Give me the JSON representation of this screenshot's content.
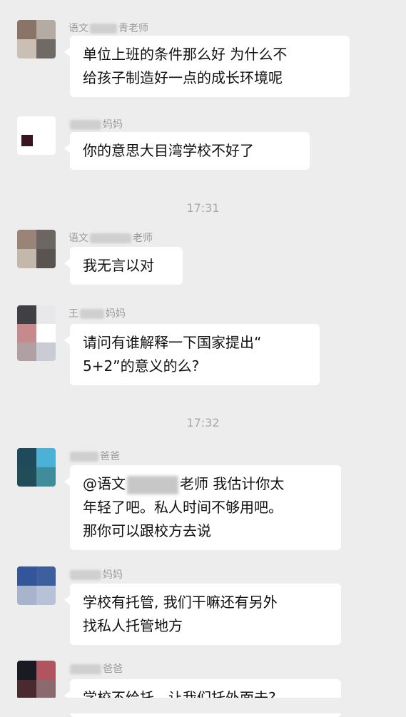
{
  "messages": [
    {
      "sender_prefix": "语文",
      "sender_suffix": "青老师",
      "lines": [
        "单位上班的条件那么好 为什么不",
        "给孩子制造好一点的成长环境呢"
      ],
      "avatar_colors": [
        "#8a7468",
        "#b4aba3",
        "#c9bfb5",
        "#6f6a66"
      ]
    },
    {
      "sender_prefix": "",
      "sender_suffix": "妈妈",
      "lines": [
        "你的意思大目湾学校不好了"
      ],
      "avatar_colors": [
        "#ffffff"
      ]
    },
    {
      "sender_prefix": "语文",
      "sender_suffix": "老师",
      "lines": [
        "我无言以对"
      ],
      "avatar_colors": [
        "#9a8478",
        "#6b6662",
        "#c4b8ac",
        "#5a5450"
      ]
    },
    {
      "sender_prefix": "王",
      "sender_suffix": "妈妈",
      "lines": [
        "请问有谁解释一下国家提出“",
        "5+2”的意义的么?"
      ],
      "avatar_colors": [
        "#3f3f44",
        "#e8e8ea",
        "#c78a8c",
        "#c9ccd4"
      ]
    },
    {
      "sender_prefix": "",
      "sender_suffix": "爸爸",
      "mention_prefix": "@语文",
      "mention_suffix": "老师 我估计你太",
      "lines": [
        "年轻了吧。私人时间不够用吧。",
        "那你可以跟校方去说"
      ],
      "avatar_colors": [
        "#1f4a5c",
        "#4cb1d6",
        "#214d58",
        "#3f8d9a"
      ]
    },
    {
      "sender_prefix": "",
      "sender_suffix": "妈妈",
      "lines": [
        "学校有托管, 我们干嘛还有另外",
        "找私人托管地方"
      ],
      "avatar_colors": [
        "#33569a",
        "#3d5f9e",
        "#a8b4cc",
        "#b8c2d6"
      ]
    },
    {
      "sender_prefix": "",
      "sender_suffix": "爸爸",
      "lines": [
        "学校不给托，让我们托外面去?"
      ],
      "avatar_colors": [
        "#1a1a22",
        "#b0555f",
        "#4a2a2e",
        "#8a6a6e"
      ]
    }
  ],
  "timestamps": [
    "17:31",
    "17:32"
  ],
  "colors": {
    "background": "#ededed",
    "bubble": "#ffffff",
    "text": "#111111",
    "meta": "#9a9a9a"
  }
}
